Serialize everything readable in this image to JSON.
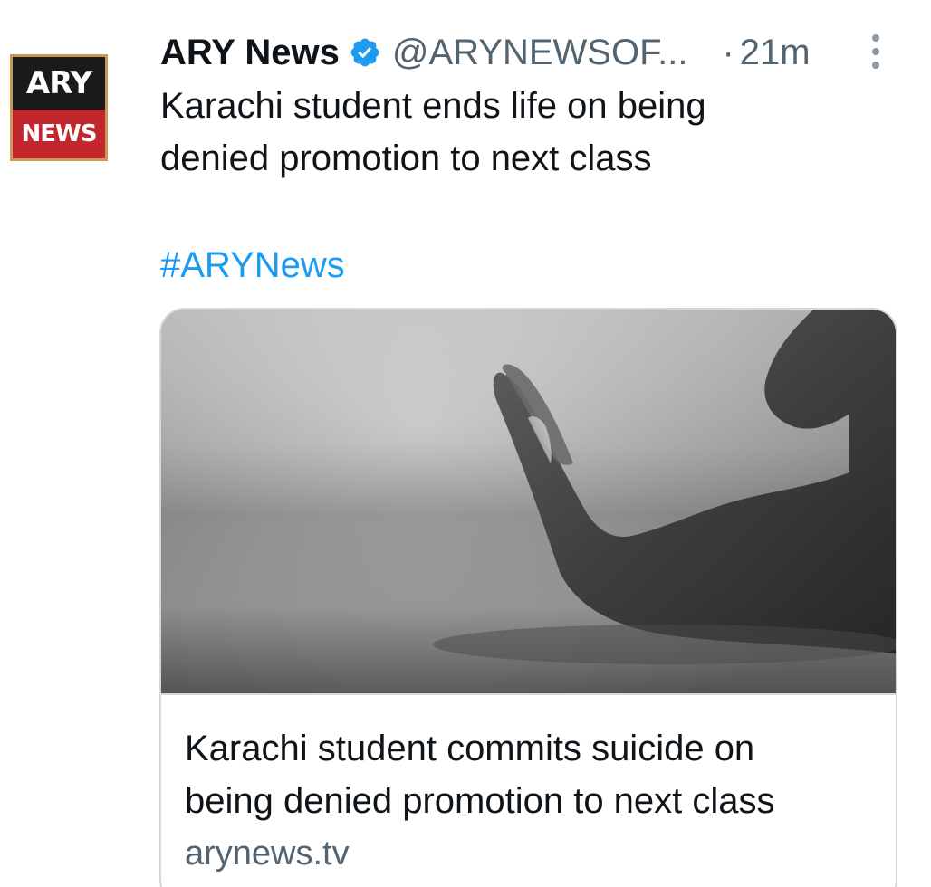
{
  "tweet": {
    "avatar": {
      "icon": "ary-news-logo",
      "logo_top_text": "ARY",
      "logo_bottom_text": "NEWS"
    },
    "display_name": "ARY News",
    "verified_icon": "verified-badge-icon",
    "handle": "@ARYNEWSOF...",
    "separator": "·",
    "time": "21m",
    "more_icon": "more-options-icon",
    "text_line_1": "Karachi student ends life on being",
    "text_line_2": "denied promotion to next class",
    "hashtag": "#ARYNews",
    "link_card": {
      "image_description_icon": "hand-on-floor-photo",
      "title_line_1": "Karachi student commits suicide on",
      "title_line_2": "being denied promotion to next class",
      "domain": "arynews.tv"
    }
  },
  "colors": {
    "text_primary": "#0f1419",
    "text_secondary": "#536471",
    "accent": "#1d9bf0",
    "card_border": "#cfd9de",
    "ary_red": "#c1272d"
  }
}
